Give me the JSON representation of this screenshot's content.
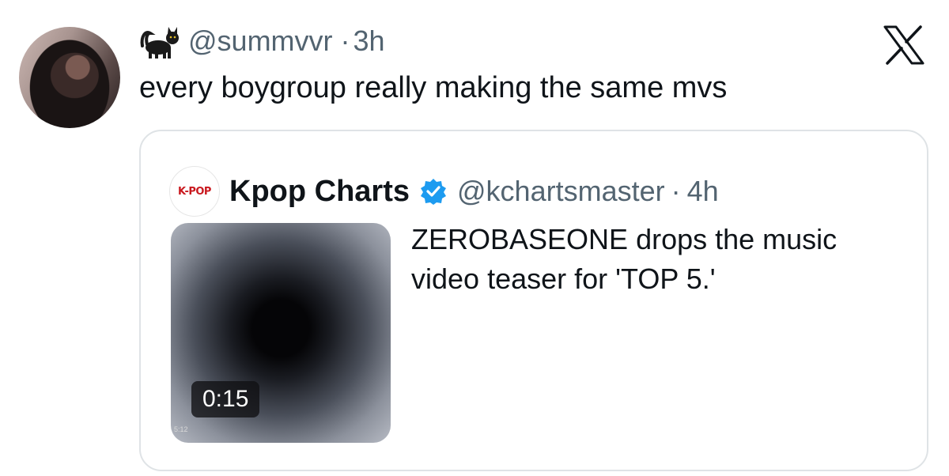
{
  "tweet": {
    "handle": "@summvvr",
    "separator": "·",
    "time": "3h",
    "text": "every boygroup really making the same mvs",
    "emoji_icon": "black-cat-icon"
  },
  "platform": {
    "logo_icon": "x-logo-icon"
  },
  "quoted": {
    "logo_text": "K-POP",
    "display_name": "Kpop Charts",
    "verified_icon": "verified-badge-icon",
    "handle": "@kchartsmaster",
    "separator": "·",
    "time": "4h",
    "text": "ZEROBASEONE drops the music video teaser for 'TOP 5.'",
    "video": {
      "duration": "0:15",
      "overlay_label": "5:12"
    }
  },
  "colors": {
    "text_primary": "#0f1419",
    "text_secondary": "#536471",
    "verified_blue": "#1d9bf0",
    "border": "#dfe3e6"
  }
}
